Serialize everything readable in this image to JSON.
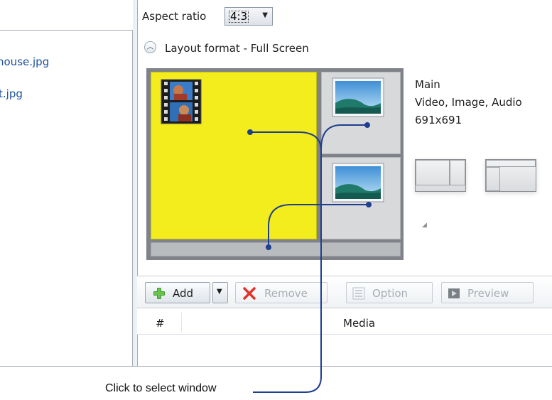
{
  "files": [
    {
      "name": "house.jpg"
    },
    {
      "name": "t.jpg"
    }
  ],
  "aspect": {
    "label": "Aspect ratio",
    "value": "4:3"
  },
  "layout": {
    "title": "Layout format - Full Screen",
    "main_color": "#f3ed1e"
  },
  "info": {
    "name": "Main",
    "types": "Video, Image, Audio",
    "size": "691x691"
  },
  "toolbar": {
    "add": "Add",
    "remove": "Remove",
    "option": "Option",
    "preview": "Preview"
  },
  "table": {
    "col_num": "#",
    "col_media": "Media"
  },
  "callout": {
    "text": "Click to select window",
    "color": "#1f3f8f"
  },
  "icons": {
    "main_window": "film-icon",
    "side_windows": "picture-icon",
    "add": "plus-icon",
    "remove": "x-icon",
    "option": "list-icon",
    "preview": "play-icon"
  }
}
